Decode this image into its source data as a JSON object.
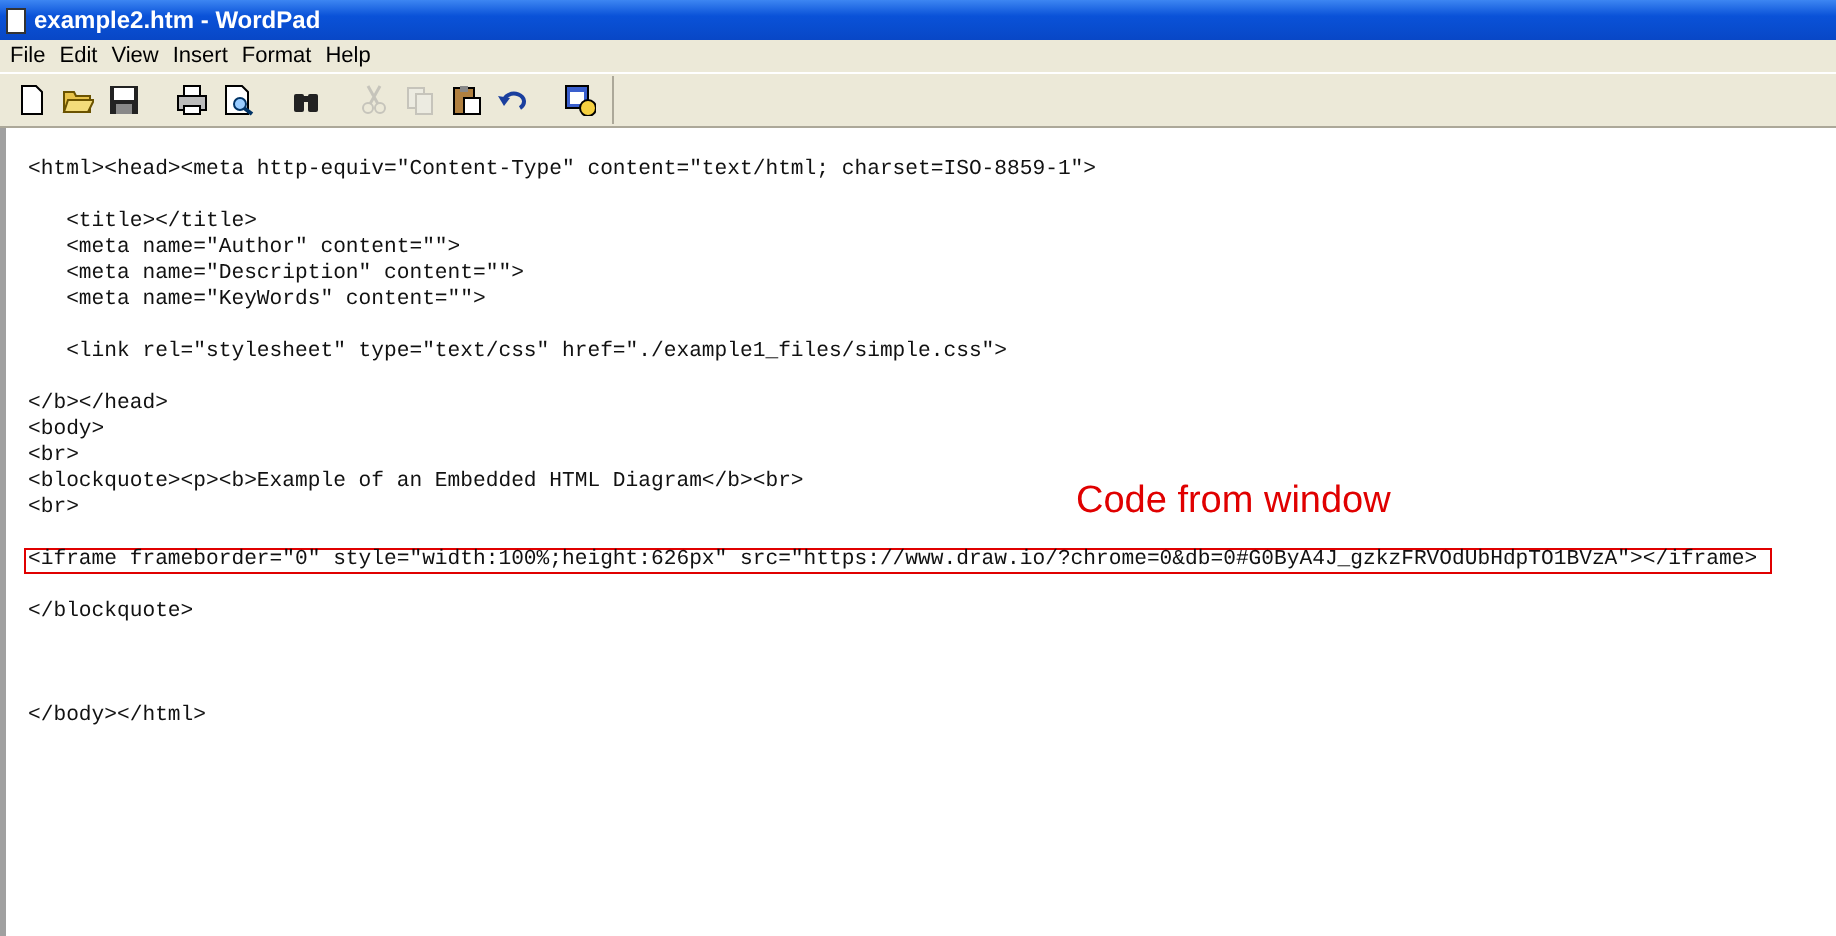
{
  "window": {
    "title": "example2.htm - WordPad"
  },
  "menu": [
    "File",
    "Edit",
    "View",
    "Insert",
    "Format",
    "Help"
  ],
  "toolbar": [
    {
      "kind": "new",
      "disabled": false
    },
    {
      "kind": "open",
      "disabled": false
    },
    {
      "kind": "save",
      "disabled": false
    },
    {
      "kind": "sep"
    },
    {
      "kind": "print",
      "disabled": false
    },
    {
      "kind": "preview",
      "disabled": false
    },
    {
      "kind": "sep"
    },
    {
      "kind": "find",
      "disabled": false
    },
    {
      "kind": "sep"
    },
    {
      "kind": "cut",
      "disabled": true
    },
    {
      "kind": "copy",
      "disabled": true
    },
    {
      "kind": "paste",
      "disabled": false
    },
    {
      "kind": "undo",
      "disabled": false
    },
    {
      "kind": "sep"
    },
    {
      "kind": "datetime",
      "disabled": false
    }
  ],
  "document": {
    "lines": [
      {
        "kind": "blank"
      },
      {
        "kind": "text",
        "text": "<html><head><meta http-equiv=\"Content-Type\" content=\"text/html; charset=ISO-8859-1\">",
        "highlighted": false
      },
      {
        "kind": "blank"
      },
      {
        "kind": "text",
        "text": "   <title></title>",
        "highlighted": false
      },
      {
        "kind": "text",
        "text": "   <meta name=\"Author\" content=\"\">",
        "highlighted": false
      },
      {
        "kind": "text",
        "text": "   <meta name=\"Description\" content=\"\">",
        "highlighted": false
      },
      {
        "kind": "text",
        "text": "   <meta name=\"KeyWords\" content=\"\">",
        "highlighted": false
      },
      {
        "kind": "blank"
      },
      {
        "kind": "text",
        "text": "   <link rel=\"stylesheet\" type=\"text/css\" href=\"./example1_files/simple.css\">",
        "highlighted": false
      },
      {
        "kind": "blank"
      },
      {
        "kind": "text",
        "text": "</b></head>",
        "highlighted": false
      },
      {
        "kind": "text",
        "text": "<body>",
        "highlighted": false
      },
      {
        "kind": "text",
        "text": "<br>",
        "highlighted": false
      },
      {
        "kind": "text",
        "text": "<blockquote><p><b>Example of an Embedded HTML Diagram</b><br>",
        "highlighted": false
      },
      {
        "kind": "text",
        "text": "<br>",
        "highlighted": false
      },
      {
        "kind": "blank"
      },
      {
        "kind": "text",
        "text": "<iframe frameborder=\"0\" style=\"width:100%;height:626px\" src=\"https://www.draw.io/?chrome=0&db=0#G0ByA4J_gzkzFRVOdUbHdpTO1BVzA\"></iframe>",
        "highlighted": true
      },
      {
        "kind": "blank"
      },
      {
        "kind": "text",
        "text": "</blockquote>",
        "highlighted": false
      },
      {
        "kind": "blank"
      },
      {
        "kind": "blank"
      },
      {
        "kind": "blank"
      },
      {
        "kind": "text",
        "text": "</body></html>",
        "highlighted": false
      }
    ]
  },
  "annotation": {
    "text": "Code from window"
  }
}
